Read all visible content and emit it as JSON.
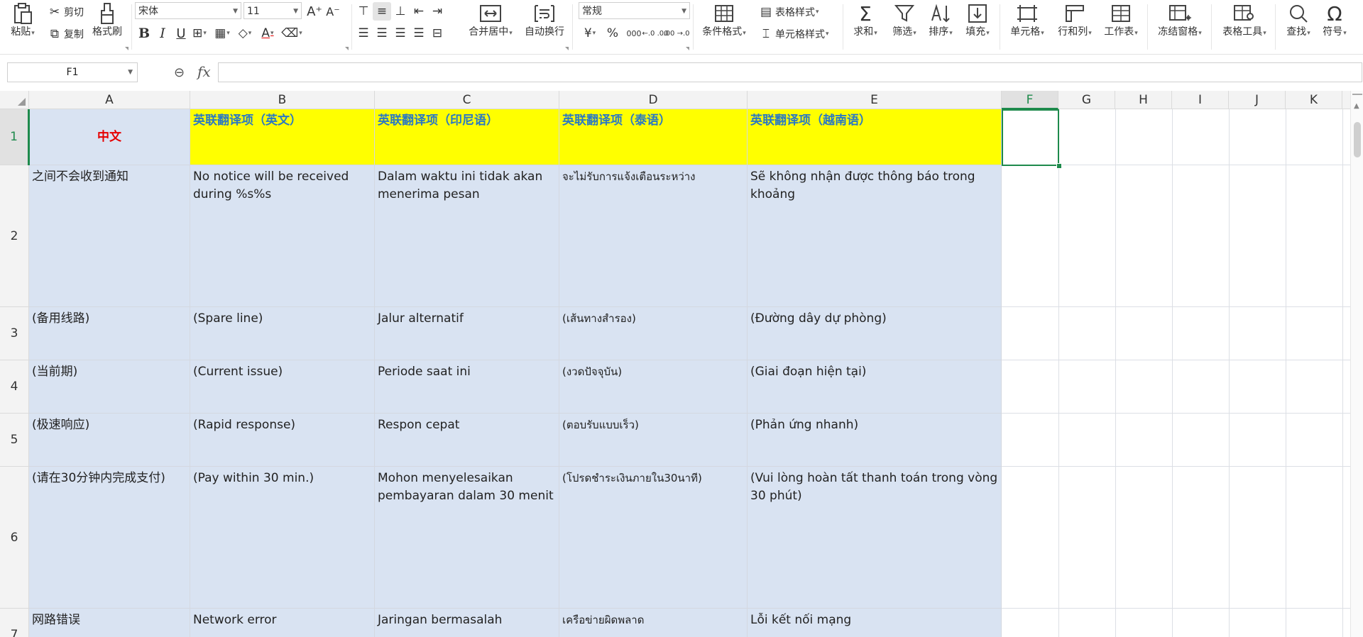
{
  "ribbon": {
    "paste": "粘贴",
    "cut": "剪切",
    "copy": "复制",
    "format_painter": "格式刷",
    "font_name": "宋体",
    "font_size": "11",
    "merge_center": "合并居中",
    "wrap_text": "自动换行",
    "number_format": "常规",
    "conditional_format": "条件格式",
    "table_style": "表格样式",
    "cell_style": "单元格样式",
    "sum": "求和",
    "filter": "筛选",
    "sort": "排序",
    "fill": "填充",
    "cell": "单元格",
    "row_col": "行和列",
    "worksheet": "工作表",
    "freeze": "冻结窗格",
    "table_tools": "表格工具",
    "find": "查找",
    "symbol": "符号",
    "currency_symbol": "¥",
    "percent_symbol": "%",
    "thousands_symbol": "000",
    "inc_decimal": "←.0 .00",
    "dec_decimal": ".00 →.0"
  },
  "formula_bar": {
    "name_box": "F1",
    "fx": "fx",
    "formula_value": ""
  },
  "columns": [
    "A",
    "B",
    "C",
    "D",
    "E",
    "F",
    "G",
    "H",
    "I",
    "J",
    "K"
  ],
  "active_column": "F",
  "rows": [
    "1",
    "2",
    "3",
    "4",
    "5",
    "6",
    "7"
  ],
  "active_row": "1",
  "cells": {
    "r1": {
      "a": "中文",
      "b": "英联翻译项（英文）",
      "c": "英联翻译项（印尼语）",
      "d": "英联翻译项（泰语）",
      "e": "英联翻译项（越南语）"
    },
    "r2": {
      "a": "之间不会收到通知",
      "b": "No notice will be received during %s%s",
      "c": "Dalam waktu ini tidak akan menerima pesan",
      "d": "จะไม่รับการแจ้งเตือนระหว่าง",
      "e": "Sẽ không nhận được thông báo trong khoảng"
    },
    "r3": {
      "a": "(备用线路)",
      "b": "(Spare line)",
      "c": "Jalur alternatif",
      "d": "(เส้นทางสำรอง)",
      "e": "(Đường dây dự phòng)"
    },
    "r4": {
      "a": "(当前期)",
      "b": "(Current issue)",
      "c": "Periode saat ini",
      "d": "(งวดปัจจุบัน)",
      "e": "(Giai đoạn hiện tại)"
    },
    "r5": {
      "a": "(极速响应)",
      "b": "(Rapid response)",
      "c": "Respon cepat",
      "d": "(ตอบรับแบบเร็ว)",
      "e": "(Phản ứng nhanh)"
    },
    "r6": {
      "a": "(请在30分钟内完成支付)",
      "b": "(Pay within 30 min.)",
      "c": "Mohon menyelesaikan pembayaran dalam 30 menit",
      "d": "(โปรดชำระเงินภายใน30นาที)",
      "e": "(Vui lòng hoàn tất thanh toán trong vòng 30 phút)"
    },
    "r7": {
      "a": "网路错误",
      "b": "Network error",
      "c": "Jaringan bermasalah",
      "d": "เครือข่ายผิดพลาด",
      "e": "Lỗi kết nối mạng"
    }
  },
  "colors": {
    "header_yellow": "#ffff00",
    "header_text_blue": "#2b79c2",
    "cell_blue": "#d9e3f2",
    "selection_green": "#1e8a4c",
    "chinese_header_red": "#e60000"
  }
}
